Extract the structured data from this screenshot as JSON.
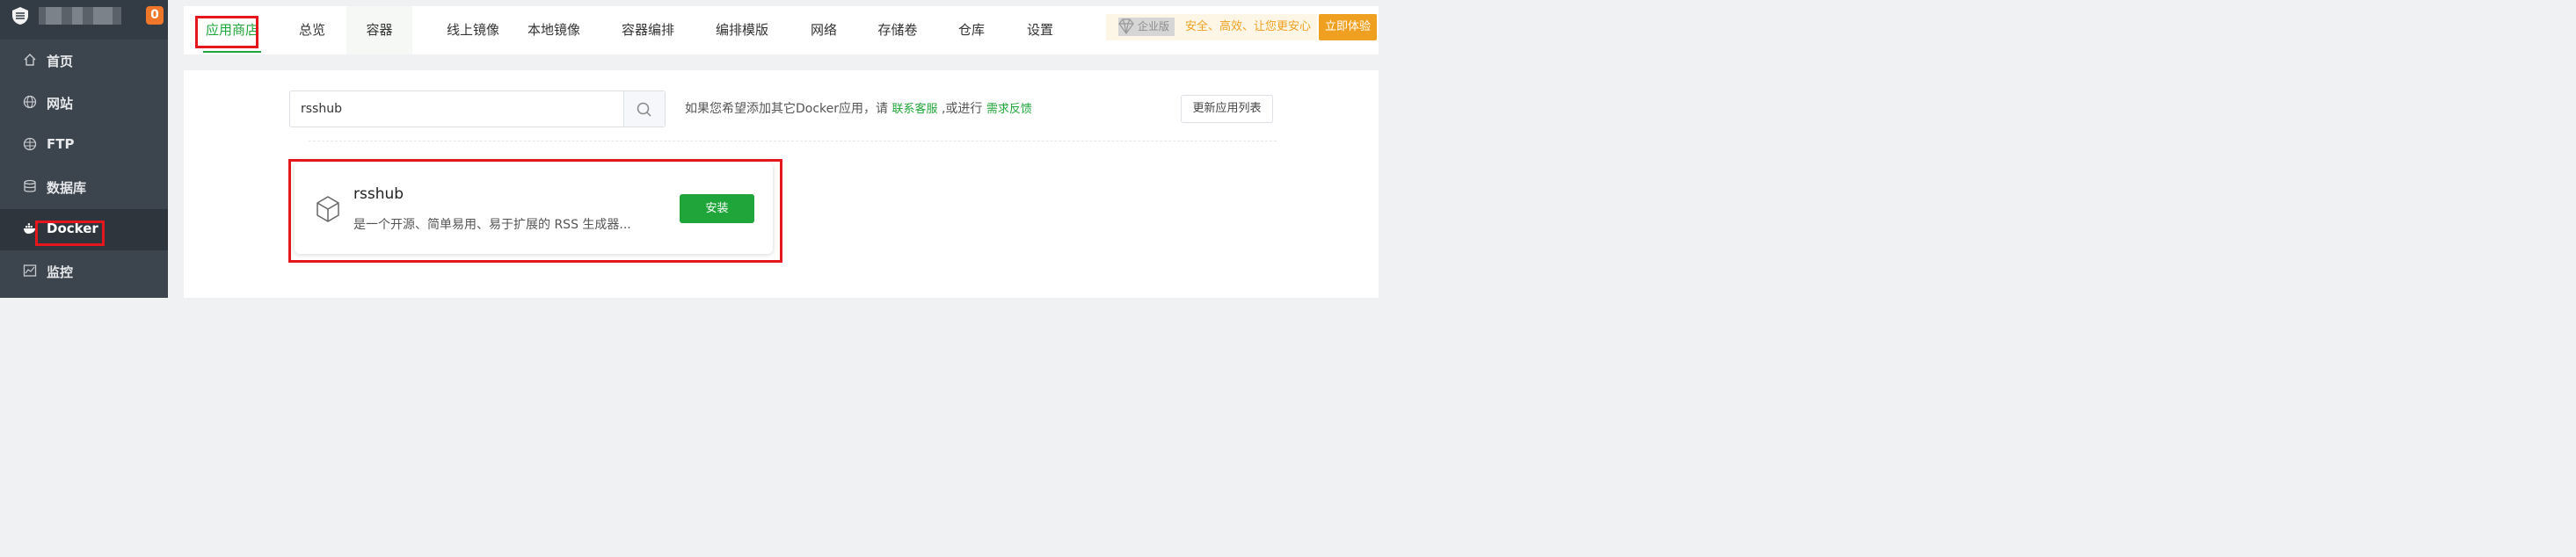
{
  "sidebar": {
    "badge": "0",
    "items": [
      {
        "label": "首页",
        "icon": "home-icon"
      },
      {
        "label": "网站",
        "icon": "globe-icon"
      },
      {
        "label": "FTP",
        "icon": "ftp-icon"
      },
      {
        "label": "数据库",
        "icon": "database-icon"
      },
      {
        "label": "Docker",
        "icon": "docker-icon",
        "active": true
      },
      {
        "label": "监控",
        "icon": "monitor-icon"
      }
    ]
  },
  "tabs": [
    {
      "label": "应用商店",
      "active": true
    },
    {
      "label": "总览"
    },
    {
      "label": "容器"
    },
    {
      "label": "线上镜像"
    },
    {
      "label": "本地镜像"
    },
    {
      "label": "容器编排"
    },
    {
      "label": "编排模版"
    },
    {
      "label": "网络"
    },
    {
      "label": "存储卷"
    },
    {
      "label": "仓库"
    },
    {
      "label": "设置"
    }
  ],
  "promo": {
    "enterprise_label": "企业版",
    "slogan": "安全、高效、让您更安心",
    "cta": "立即体验"
  },
  "search": {
    "value": "rsshub",
    "icon": "search-icon"
  },
  "hint": {
    "text": "如果您希望添加其它Docker应用，请",
    "contact_link": "联系客服",
    "middle": ",或进行",
    "feedback_link": "需求反馈"
  },
  "refresh_button": "更新应用列表",
  "app_card": {
    "name": "rsshub",
    "description": "是一个开源、简单易用、易于扩展的 RSS 生成器...",
    "install_label": "安装",
    "icon": "cube-icon"
  },
  "colors": {
    "accent": "#20a53a",
    "highlight": "#e6161d",
    "promo": "#f0a020",
    "sidebar": "#3c444d"
  }
}
